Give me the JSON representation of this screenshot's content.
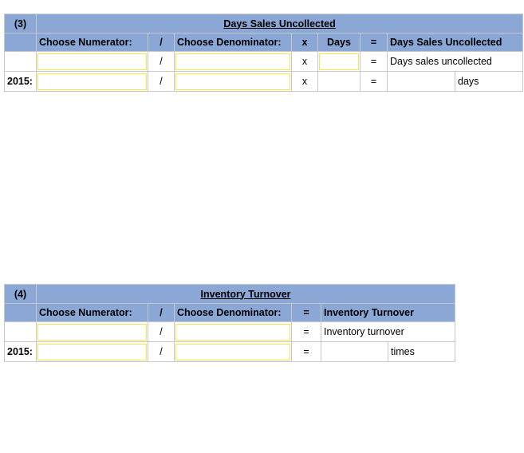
{
  "tables": [
    {
      "number": "(3)",
      "title": "Days Sales Uncollected",
      "headers": {
        "numerator": "Choose Numerator:",
        "divide": "/",
        "denominator": "Choose Denominator:",
        "multiply": "x",
        "days": "Days",
        "equals": "=",
        "result": "Days Sales Uncollected"
      },
      "row1": {
        "label": "",
        "divide": "/",
        "multiply": "x",
        "equals": "=",
        "result": "Days sales uncollected",
        "numerator_value": "",
        "denominator_value": "",
        "days_value": ""
      },
      "row2": {
        "label": "2015:",
        "divide": "/",
        "multiply": "x",
        "equals": "=",
        "result_value": "",
        "unit": "days",
        "numerator_value": "",
        "denominator_value": ""
      }
    },
    {
      "number": "(4)",
      "title": "Inventory Turnover",
      "headers": {
        "numerator": "Choose Numerator:",
        "divide": "/",
        "denominator": "Choose Denominator:",
        "equals": "=",
        "result": "Inventory Turnover"
      },
      "row1": {
        "label": "",
        "divide": "/",
        "equals": "=",
        "result": "Inventory turnover",
        "numerator_value": "",
        "denominator_value": ""
      },
      "row2": {
        "label": "2015:",
        "divide": "/",
        "equals": "=",
        "result_value": "",
        "unit": "times",
        "numerator_value": "",
        "denominator_value": ""
      }
    }
  ]
}
